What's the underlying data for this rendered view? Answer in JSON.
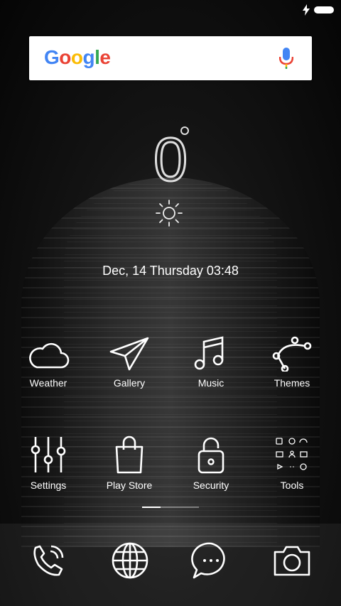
{
  "search": {
    "logo_text": "Google"
  },
  "weather": {
    "temperature": "0"
  },
  "clock": {
    "datetime": "Dec, 14  Thursday 03:48"
  },
  "apps_row1": [
    {
      "label": "Weather",
      "icon": "cloud-icon"
    },
    {
      "label": "Gallery",
      "icon": "paper-plane-icon"
    },
    {
      "label": "Music",
      "icon": "music-note-icon"
    },
    {
      "label": "Themes",
      "icon": "bezier-icon"
    }
  ],
  "apps_row2": [
    {
      "label": "Settings",
      "icon": "sliders-icon"
    },
    {
      "label": "Play Store",
      "icon": "shopping-bag-icon"
    },
    {
      "label": "Security",
      "icon": "lock-icon"
    },
    {
      "label": "Tools",
      "icon": "tools-grid-icon"
    }
  ],
  "dock": [
    {
      "icon": "phone-icon"
    },
    {
      "icon": "globe-icon"
    },
    {
      "icon": "message-icon"
    },
    {
      "icon": "camera-icon"
    }
  ],
  "colors": {
    "google_blue": "#4285F4",
    "google_red": "#EA4335",
    "google_yellow": "#FBBC05",
    "google_green": "#34A853"
  }
}
